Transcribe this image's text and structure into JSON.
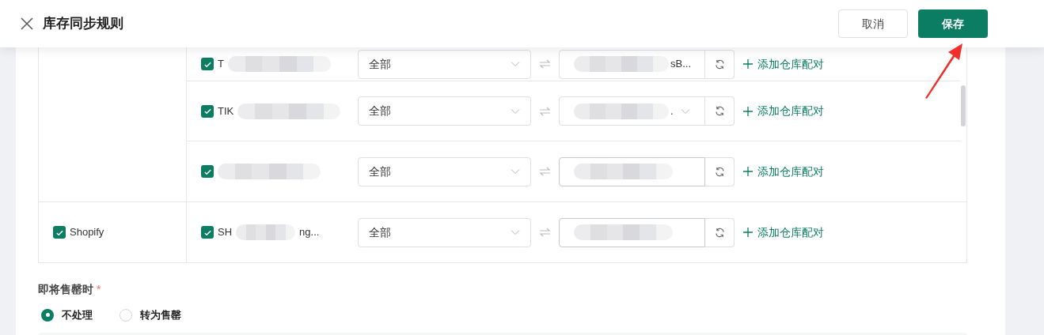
{
  "header": {
    "title": "库存同步规则",
    "buttons": [
      {
        "label": "取消",
        "kind": "secondary"
      },
      {
        "label": "保存",
        "kind": "primary"
      }
    ]
  },
  "groups": [
    {
      "rows": [
        {
          "store": "T",
          "checked": true,
          "filter": "全部",
          "warehouse": "sB...",
          "kind": "select",
          "add": "添加仓库配对"
        },
        {
          "store": "TIK",
          "checked": true,
          "filter": "全部",
          "warehouse": ".",
          "kind": "select",
          "add": "添加仓库配对"
        },
        {
          "checked": true,
          "filter": "全部",
          "kind": "input",
          "add": "添加仓库配对"
        }
      ]
    },
    {
      "platform": "Shopify",
      "checked": true,
      "rows": [
        {
          "store": "SH",
          "store_tail": "ng...",
          "checked": true,
          "filter": "全部",
          "kind": "input",
          "add": "添加仓库配对"
        }
      ]
    }
  ],
  "soldout": {
    "label": "即将售罄时",
    "required_mark": "*",
    "options": [
      {
        "label": "不处理",
        "selected": true
      },
      {
        "label": "转为售罄",
        "selected": false
      }
    ]
  }
}
